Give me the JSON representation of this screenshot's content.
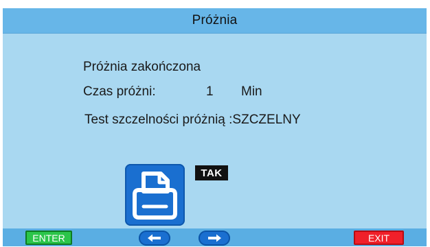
{
  "header": {
    "title": "Próżnia"
  },
  "message": {
    "line1": "Próżnia zakończona",
    "time_label": "Czas próżni:",
    "time_value": "1",
    "time_unit": "Min",
    "test_line": "Test szczelności próżnią :SZCZELNY"
  },
  "print": {
    "icon": "printer-icon",
    "badge": "TAK"
  },
  "footer": {
    "enter_label": "ENTER",
    "exit_label": "EXIT",
    "left_icon": "arrow-left-icon",
    "right_icon": "arrow-right-icon"
  },
  "colors": {
    "background": "#a9d8f1",
    "title_bar": "#67b6e8",
    "bottom_bar": "#5aaee3",
    "enter_green": "#2bc54a",
    "exit_red": "#f0202a",
    "icon_blue": "#1a6fd0"
  }
}
